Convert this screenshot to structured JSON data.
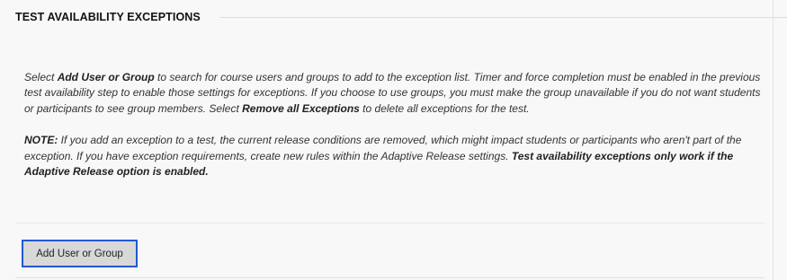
{
  "section": {
    "title": "TEST AVAILABILITY EXCEPTIONS"
  },
  "instructions": {
    "p1": {
      "t1": "Select ",
      "b1": "Add User or Group",
      "t2": " to search for course users and groups to add to the exception list. Timer and force completion must be enabled in the previous test availability step to enable those settings for exceptions. If you choose to use groups, you must make the group unavailable if you do not want students or participants to see group members. Select ",
      "b2": "Remove all Exceptions",
      "t3": " to delete all exceptions for the test."
    },
    "p2": {
      "b1": "NOTE:",
      "t1": " If you add an exception to a test, the current release conditions are removed, which might impact students or participants who aren't part of the exception. If you have exception requirements, create new rules within the Adaptive Release settings. ",
      "b2": "Test availability exceptions only work if the Adaptive Release option is enabled."
    }
  },
  "actions": {
    "add_user_or_group_label": "Add User or Group"
  },
  "colors": {
    "focus_border": "#2457d4",
    "button_bg": "#d8d8d8",
    "page_bg": "#f8f8f8"
  }
}
